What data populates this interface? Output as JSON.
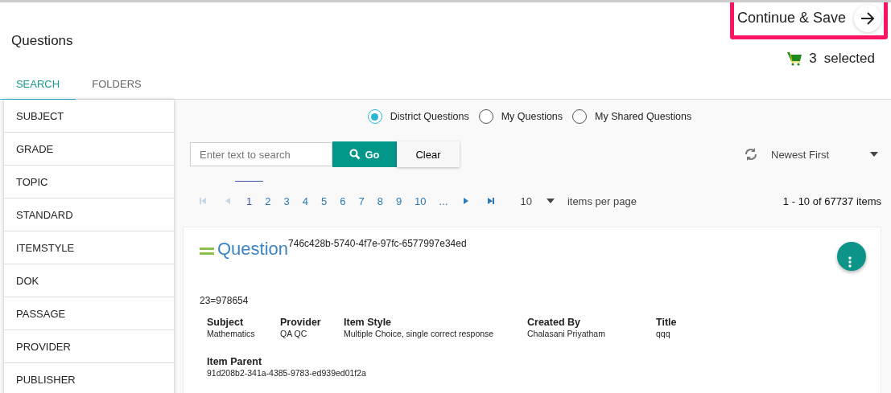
{
  "header": {
    "title": "Questions",
    "continue_button": "Continue & Save",
    "cart": {
      "count": "3",
      "label": "selected"
    }
  },
  "tabs": [
    {
      "label": "SEARCH",
      "selected": true
    },
    {
      "label": "FOLDERS",
      "selected": false
    }
  ],
  "filters": [
    "SUBJECT",
    "GRADE",
    "TOPIC",
    "STANDARD",
    "ITEMSTYLE",
    "DOK",
    "PASSAGE",
    "PROVIDER",
    "PUBLISHER"
  ],
  "scope_options": [
    {
      "label": "District Questions",
      "selected": true
    },
    {
      "label": "My Questions",
      "selected": false
    },
    {
      "label": "My Shared Questions",
      "selected": false
    }
  ],
  "search": {
    "placeholder": "Enter text to search",
    "go_button": "Go",
    "clear_button": "Clear"
  },
  "sort": {
    "value": "Newest First"
  },
  "pagination": {
    "first_disabled": true,
    "prev_disabled": true,
    "next_disabled": false,
    "last_disabled": false,
    "pages": [
      {
        "label": "1",
        "selected": true
      },
      {
        "label": "2",
        "selected": false
      },
      {
        "label": "3",
        "selected": false
      },
      {
        "label": "4",
        "selected": false
      },
      {
        "label": "5",
        "selected": false
      },
      {
        "label": "6",
        "selected": false
      },
      {
        "label": "7",
        "selected": false
      },
      {
        "label": "8",
        "selected": false
      },
      {
        "label": "9",
        "selected": false
      },
      {
        "label": "10",
        "selected": false
      },
      {
        "label": "...",
        "selected": false
      }
    ],
    "page_size": "10",
    "page_size_label": "items per page",
    "summary": "1 - 10 of 67737 items"
  },
  "question": {
    "title": "Question",
    "id": "746c428b-5740-4f7e-97fc-6577997e34ed",
    "text": "23=978654",
    "fields": [
      {
        "label": "Subject",
        "value": "Mathematics"
      },
      {
        "label": "Provider",
        "value": "QA QC"
      },
      {
        "label": "Item Style",
        "value": "Multiple Choice, single correct response"
      },
      {
        "label": "Created By",
        "value": "Chalasani Priyatham"
      },
      {
        "label": "Title",
        "value": "qqq"
      }
    ],
    "parent": {
      "label": "Item Parent",
      "value": "91d208b2-341a-4385-9783-ed939ed01f2a"
    }
  }
}
